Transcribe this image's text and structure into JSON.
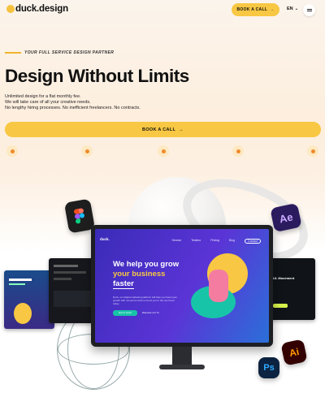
{
  "header": {
    "logo": "duck.design",
    "book_label": "BOOK A CALL",
    "book_arrow": "→",
    "lang": "EN",
    "lang_chevron": "⌄"
  },
  "hero": {
    "tagline": "YOUR FULL SERVICE DESIGN PARTNER",
    "title": "Design Without Limits",
    "desc_lines": [
      "Unlimited design for a flat monthly fee.",
      "We will take care of all your creative needs.",
      "No lengthy hiring processes. No inefficient freelancers. No contracts."
    ],
    "cta_label": "BOOK A CALL",
    "cta_arrow": "→"
  },
  "socials": [
    "dribbble-icon",
    "behance-icon",
    "producthunt-icon",
    "instagram-icon",
    "youtube-icon"
  ],
  "monitor": {
    "logo": "duck.",
    "nav": [
      "Service",
      "Testimo",
      "Pricing",
      "Blog",
      "Contact"
    ],
    "headline_1": "We help you grow",
    "headline_2": "your business",
    "headline_3": "faster",
    "subtext": "Duck, our digital marketing platform will help you boost your growth with numerous tools to boost you to the next level today.",
    "cta_primary": "Get in touch",
    "cta_secondary": "Discover our Tx"
  },
  "side_screens": {
    "right_title": "UL Movement"
  },
  "app_icons": {
    "ae": "Ae",
    "ps": "Ps",
    "ai": "Ai"
  },
  "colors": {
    "accent": "#f8c743",
    "monitor_bg": "#5b34d6",
    "teal": "#18c4a8"
  }
}
